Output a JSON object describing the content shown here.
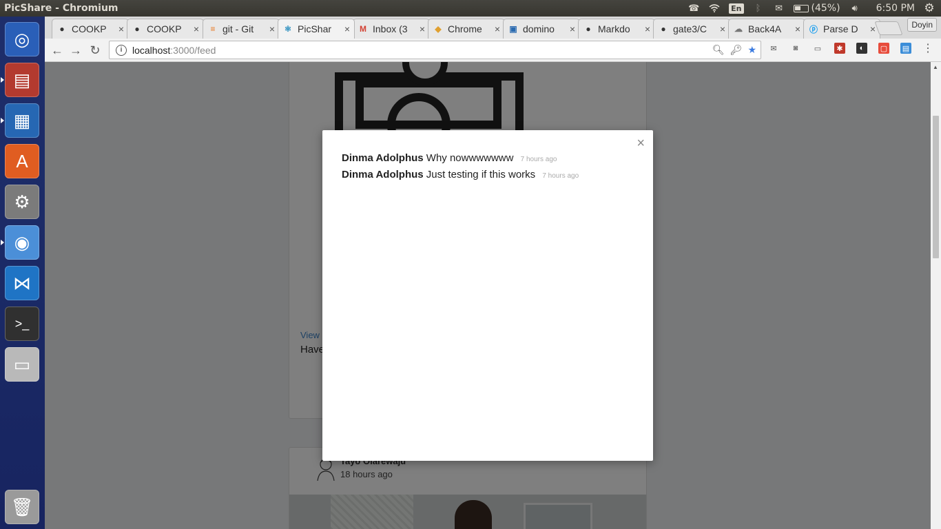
{
  "os": {
    "window_title": "PicShare - Chromium",
    "keyboard_layout": "En",
    "battery": "(45%)",
    "clock": "6:50 PM",
    "icons": [
      "phone-icon",
      "wifi-icon",
      "bluetooth-icon",
      "mail-icon",
      "battery-icon",
      "volume-icon",
      "system-gear-icon"
    ]
  },
  "launcher": {
    "items": [
      {
        "name": "ubuntu-dash-icon",
        "color": "#2a5fb8"
      },
      {
        "name": "files-icon",
        "color": "#b33a2f"
      },
      {
        "name": "writer-icon",
        "color": "#2667b3"
      },
      {
        "name": "software-center-icon",
        "color": "#e05d21"
      },
      {
        "name": "system-settings-icon",
        "color": "#7b7b7b"
      },
      {
        "name": "chromium-icon",
        "color": "#4b8fd8"
      },
      {
        "name": "vscode-icon",
        "color": "#1f74c5"
      },
      {
        "name": "terminal-icon",
        "color": "#303030"
      },
      {
        "name": "disk-icon",
        "color": "#b9b9b9"
      },
      {
        "name": "trash-icon",
        "color": "#9a9a9a"
      }
    ]
  },
  "browser": {
    "tabs": [
      {
        "label": "COOKP",
        "icon": "github-icon",
        "active": false
      },
      {
        "label": "COOKP",
        "icon": "github-icon",
        "active": false
      },
      {
        "label": "git - Git",
        "icon": "stackoverflow-icon",
        "active": false
      },
      {
        "label": "PicShar",
        "icon": "react-icon",
        "active": true
      },
      {
        "label": "Inbox (3",
        "icon": "gmail-icon",
        "active": false
      },
      {
        "label": "Chrome",
        "icon": "chrome-store-icon",
        "active": false
      },
      {
        "label": "domino",
        "icon": "site-icon",
        "active": false
      },
      {
        "label": "Markdo",
        "icon": "github-icon",
        "active": false
      },
      {
        "label": "gate3/C",
        "icon": "github-icon",
        "active": false
      },
      {
        "label": "Back4A",
        "icon": "back4app-icon",
        "active": false
      },
      {
        "label": "Parse D",
        "icon": "parse-icon",
        "active": false
      }
    ],
    "profile": "Doyin",
    "url_host": "localhost",
    "url_path": ":3000/feed"
  },
  "feed": {
    "post1": {
      "view_link": "View",
      "caption": "Have"
    },
    "post2": {
      "author": "Tayo Olarewaju",
      "time": "18 hours ago"
    }
  },
  "modal": {
    "close": "×",
    "comments": [
      {
        "author": "Dinma Adolphus",
        "text": "Why nowwwwwww",
        "time": "7 hours ago"
      },
      {
        "author": "Dinma Adolphus",
        "text": "Just testing if this works",
        "time": "7 hours ago"
      }
    ]
  }
}
